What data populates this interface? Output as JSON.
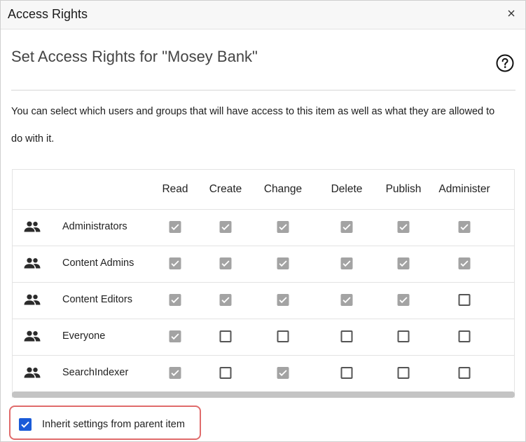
{
  "dialog": {
    "title": "Access Rights",
    "heading": "Set Access Rights for \"Mosey Bank\"",
    "description": "You can select which users and groups that will have access to this item as well as what they are allowed to do with it."
  },
  "table": {
    "columns": [
      "Read",
      "Create",
      "Change",
      "Delete",
      "Publish",
      "Administer"
    ],
    "rows": [
      {
        "name": "Administrators",
        "icon": "group-icon",
        "rights": [
          true,
          true,
          true,
          true,
          true,
          true
        ]
      },
      {
        "name": "Content Admins",
        "icon": "group-icon",
        "rights": [
          true,
          true,
          true,
          true,
          true,
          true
        ]
      },
      {
        "name": "Content Editors",
        "icon": "group-icon",
        "rights": [
          true,
          true,
          true,
          true,
          true,
          false
        ]
      },
      {
        "name": "Everyone",
        "icon": "group-icon",
        "rights": [
          true,
          false,
          false,
          false,
          false,
          false
        ]
      },
      {
        "name": "SearchIndexer",
        "icon": "group-icon",
        "rights": [
          true,
          false,
          true,
          false,
          false,
          false
        ]
      }
    ]
  },
  "inherit": {
    "label": "Inherit settings from parent item",
    "checked": true
  },
  "colors": {
    "checked_disabled": "#a3a3a3",
    "checkbox_accent": "#1a5bd8",
    "highlight_border": "#e06b6b"
  }
}
